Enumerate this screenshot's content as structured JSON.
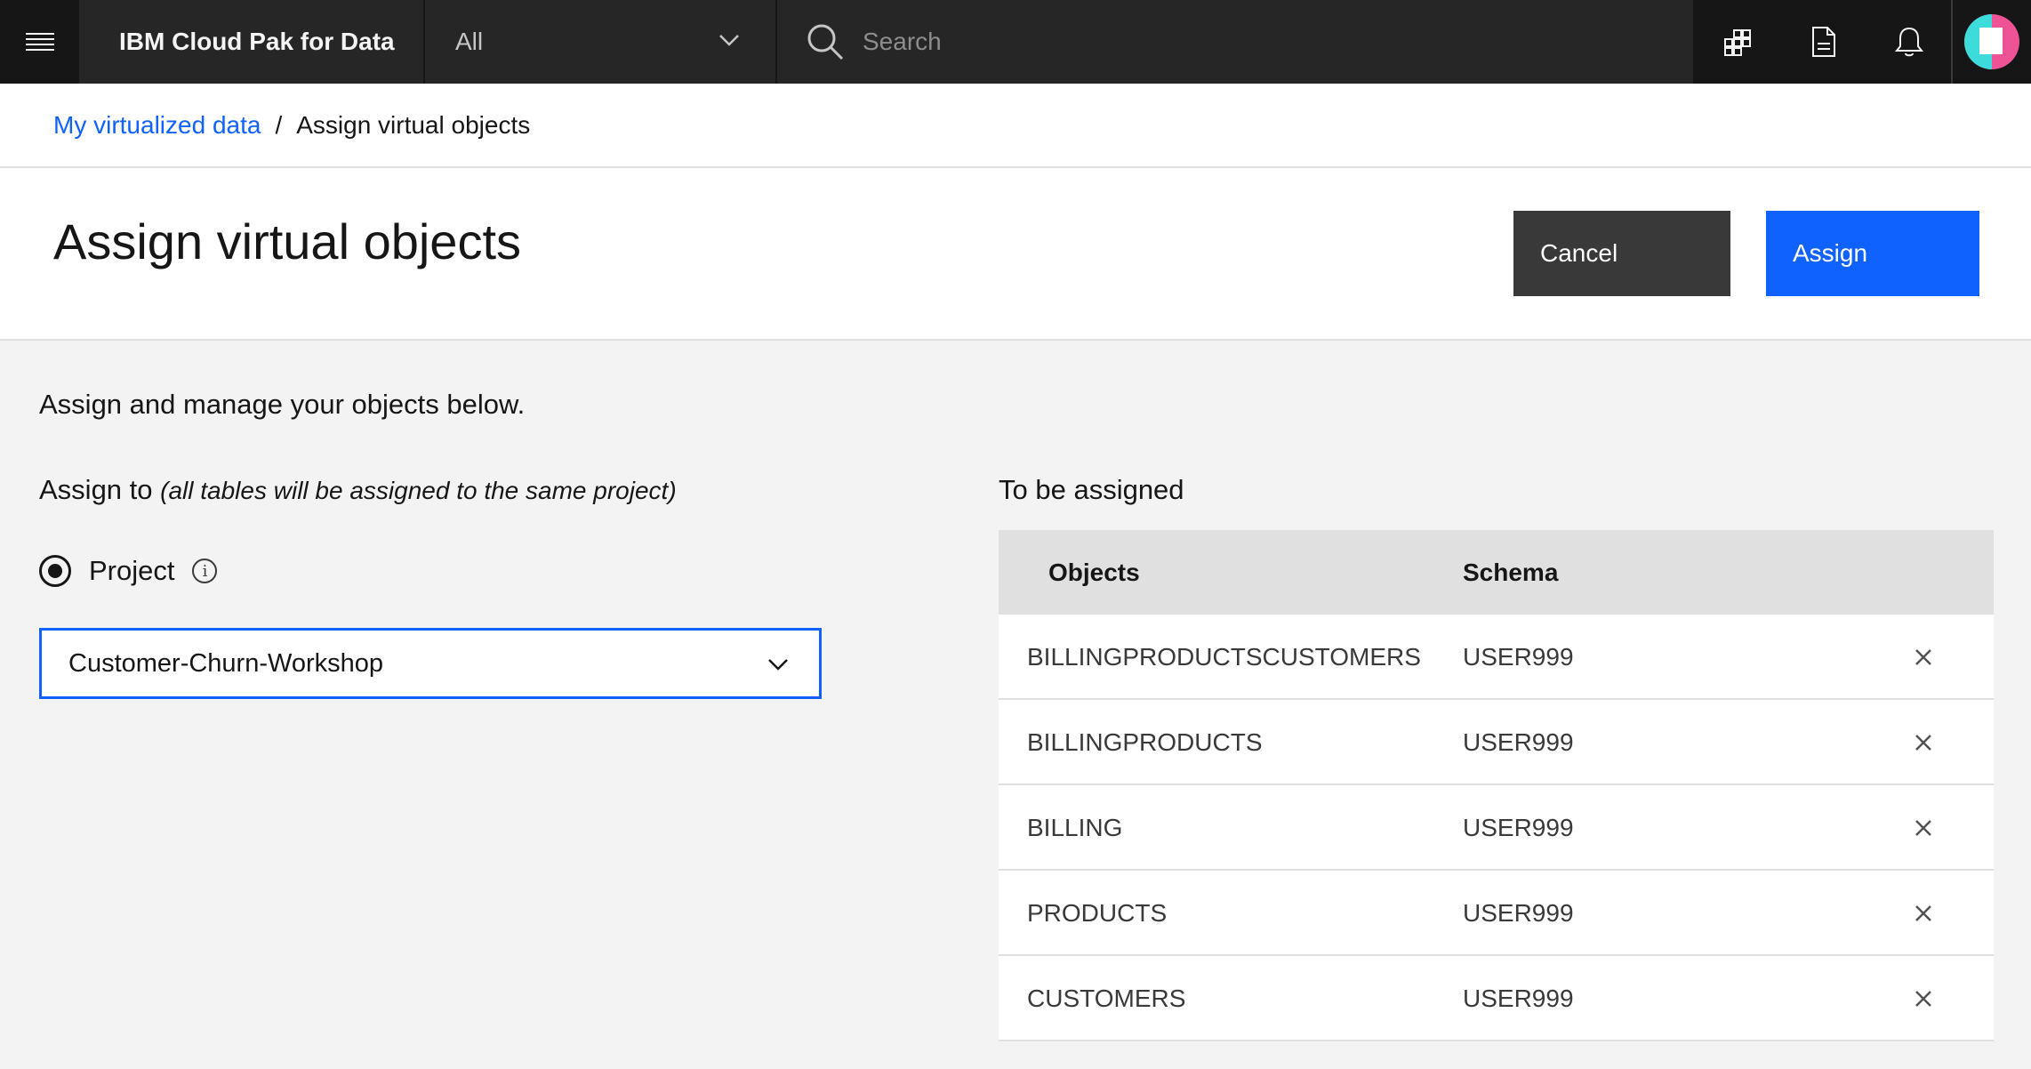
{
  "topbar": {
    "brand": "IBM Cloud Pak for Data",
    "scope": "All",
    "search_placeholder": "Search"
  },
  "breadcrumb": {
    "link": "My virtualized data",
    "separator": "/",
    "current": "Assign virtual objects"
  },
  "header": {
    "title": "Assign virtual objects",
    "cancel_label": "Cancel",
    "assign_label": "Assign"
  },
  "body": {
    "intro": "Assign and manage your objects below.",
    "assign_to_label": "Assign to",
    "assign_to_hint": "(all tables will be assigned to the same project)",
    "radio_label": "Project",
    "project_select": "Customer-Churn-Workshop"
  },
  "to_be_assigned": {
    "label": "To be assigned",
    "columns": {
      "objects": "Objects",
      "schema": "Schema"
    },
    "rows": [
      {
        "object": "BILLINGPRODUCTSCUSTOMERS",
        "schema": "USER999"
      },
      {
        "object": "BILLINGPRODUCTS",
        "schema": "USER999"
      },
      {
        "object": "BILLING",
        "schema": "USER999"
      },
      {
        "object": "PRODUCTS",
        "schema": "USER999"
      },
      {
        "object": "CUSTOMERS",
        "schema": "USER999"
      }
    ]
  },
  "colors": {
    "primary": "#0f62fe",
    "nav_bg": "#161616",
    "secondary_button": "#393939"
  }
}
